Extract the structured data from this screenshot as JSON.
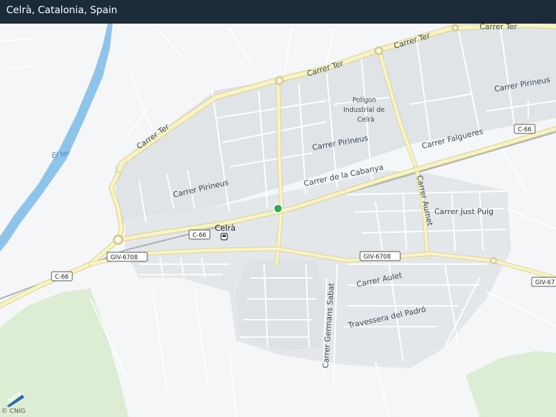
{
  "header": {
    "title": "Celrà, Catalonia, Spain"
  },
  "map": {
    "center_marker": {
      "name": "location-pin"
    },
    "water": {
      "river_label": "El ter"
    },
    "districts": {
      "industrial": "Polígon Industrial de Celrà",
      "industrial_lines": [
        "Polígon",
        "Industrial de",
        "Celrà"
      ]
    },
    "places": {
      "town": "Celrà"
    },
    "streets": {
      "carrer_ter": "Carrer Ter",
      "carrer_pirineus": "Carrer Pirineus",
      "carrer_cabanya": "Carrer de la Cabanya",
      "carrer_falgueres": "Carrer Falgueres",
      "carrer_aumet": "Carrer Aumet",
      "carrer_just_puig": "Carrer Just Puig",
      "carrer_aulet": "Carrer Aulet",
      "carrer_germans_sabat": "Carrer Germans Sabat",
      "travessera_padro": "Travessera del Padró"
    },
    "shields": {
      "c66": "C-66",
      "giv6708": "GIV-6708",
      "giv67": "GIV-67"
    },
    "colors": {
      "road_major": "#f7f3c6",
      "road_edge": "#d9cf86",
      "urban": "#e0e4e7",
      "water": "#8ec3ea",
      "park": "#dcedd4"
    }
  },
  "footer": {
    "copyright": "© CNIG",
    "logo": "here"
  }
}
